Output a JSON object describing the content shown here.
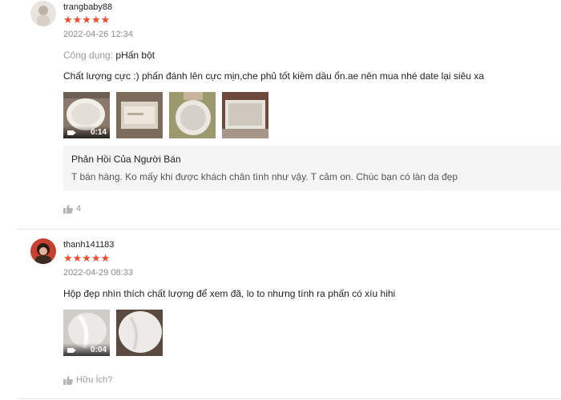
{
  "reviews": [
    {
      "username": "trangbaby88",
      "stars": "★★★★★",
      "rating": 5,
      "time": "2022-04-26 12:34",
      "attr_key": "Công dụng:",
      "attr_value": "pHấn bột",
      "comment": "Chất lượng cực :) phấn đánh lên cực mịn,che phủ tốt kiềm dầu ổn.ae nên mua nhé date lại siêu xa",
      "video_duration": "0:14",
      "reply_title": "Phản Hồi Của Người Bán",
      "reply_text": "T bán hàng. Ko mấy khi được khách chân tình như vậy. T cảm on. Chúc bạn có làn da đẹp",
      "like_count": "4"
    },
    {
      "username": "thanh141183",
      "stars": "★★★★★",
      "rating": 5,
      "time": "2022-04-29 08:33",
      "comment": "Hộp đẹp nhìn thích chất lượng để xem đã, lo to nhưng tính ra phấn có xíu hihi",
      "video_duration": "0:04",
      "like_label": "Hữu Ích?"
    }
  ],
  "colors": {
    "star": "#ee4d2d",
    "muted": "#9a9a9a",
    "reply_bg": "#f5f5f5"
  }
}
